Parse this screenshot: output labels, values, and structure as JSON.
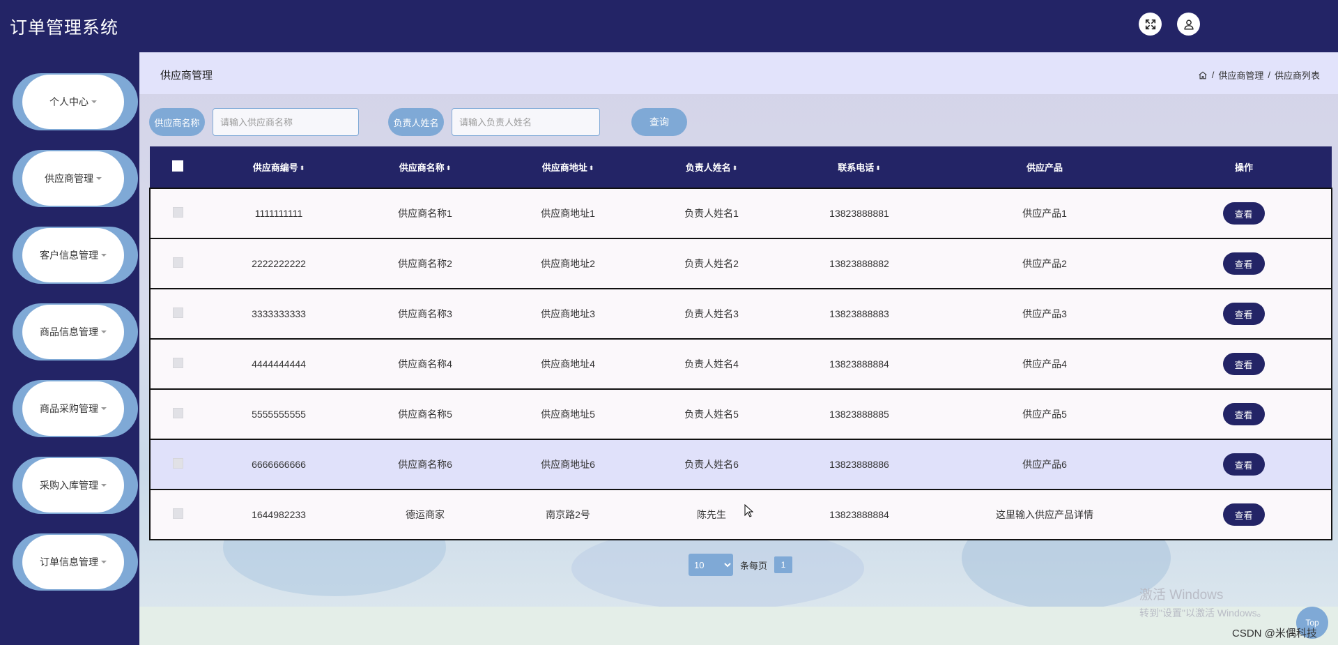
{
  "app": {
    "title": "订单管理系统"
  },
  "header_icons": [
    "fullscreen-icon",
    "user-icon"
  ],
  "sidebar": {
    "items": [
      {
        "label": "个人中心"
      },
      {
        "label": "供应商管理"
      },
      {
        "label": "客户信息管理"
      },
      {
        "label": "商品信息管理"
      },
      {
        "label": "商品采购管理"
      },
      {
        "label": "采购入库管理"
      },
      {
        "label": "订单信息管理"
      }
    ]
  },
  "page": {
    "title": "供应商管理",
    "breadcrumb": [
      "供应商管理",
      "供应商列表"
    ]
  },
  "search": {
    "supplier_label": "供应商名称",
    "supplier_placeholder": "请输入供应商名称",
    "contact_label": "负责人姓名",
    "contact_placeholder": "请输入负责人姓名",
    "query_button": "查询"
  },
  "table": {
    "headers": [
      "供应商编号",
      "供应商名称",
      "供应商地址",
      "负责人姓名",
      "联系电话",
      "供应产品",
      "操作"
    ],
    "rows": [
      {
        "id": "1111111111",
        "name": "供应商名称1",
        "address": "供应商地址1",
        "contact": "负责人姓名1",
        "phone": "13823888881",
        "product": "供应产品1",
        "action": "查看"
      },
      {
        "id": "2222222222",
        "name": "供应商名称2",
        "address": "供应商地址2",
        "contact": "负责人姓名2",
        "phone": "13823888882",
        "product": "供应产品2",
        "action": "查看"
      },
      {
        "id": "3333333333",
        "name": "供应商名称3",
        "address": "供应商地址3",
        "contact": "负责人姓名3",
        "phone": "13823888883",
        "product": "供应产品3",
        "action": "查看"
      },
      {
        "id": "4444444444",
        "name": "供应商名称4",
        "address": "供应商地址4",
        "contact": "负责人姓名4",
        "phone": "13823888884",
        "product": "供应产品4",
        "action": "查看"
      },
      {
        "id": "5555555555",
        "name": "供应商名称5",
        "address": "供应商地址5",
        "contact": "负责人姓名5",
        "phone": "13823888885",
        "product": "供应产品5",
        "action": "查看"
      },
      {
        "id": "6666666666",
        "name": "供应商名称6",
        "address": "供应商地址6",
        "contact": "负责人姓名6",
        "phone": "13823888886",
        "product": "供应产品6",
        "action": "查看"
      },
      {
        "id": "1644982233",
        "name": "德运商家",
        "address": "南京路2号",
        "contact": "陈先生",
        "phone": "13823888884",
        "product": "这里输入供应产品详情",
        "action": "查看"
      }
    ]
  },
  "pagination": {
    "page_size": "10",
    "per_page_label": "条每页",
    "current_page": "1"
  },
  "overlay": {
    "windows_line1": "激活 Windows",
    "windows_line2": "转到\"设置\"以激活 Windows。",
    "watermark": "CSDN @米偶科技",
    "top_button": "Top"
  },
  "colors": {
    "primary": "#232466",
    "accent": "#7fa9d6",
    "highlight_row": "#e0e1fa"
  }
}
